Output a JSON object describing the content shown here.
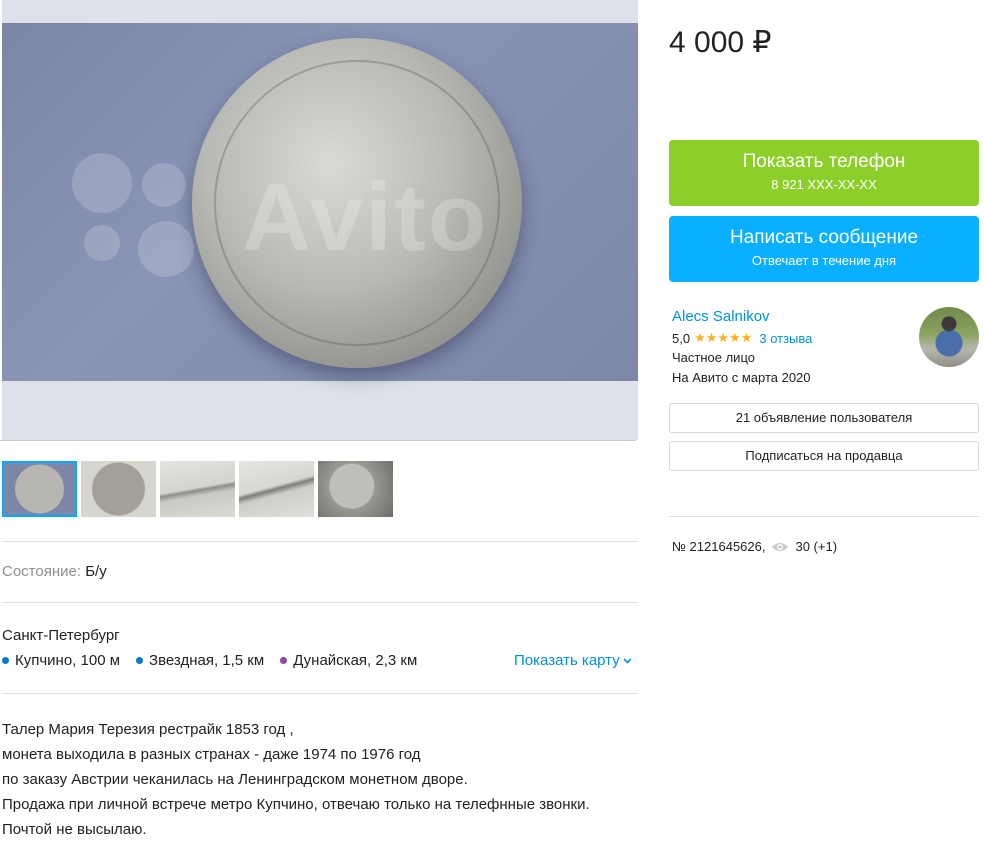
{
  "gallery": {
    "watermark": "Avito",
    "thumbnails": [
      "coin-obverse",
      "coin-reverse",
      "coin-edge-1",
      "coin-edge-2",
      "coin-in-holder"
    ]
  },
  "params": {
    "condition_label": "Состояние:",
    "condition_value": "Б/у"
  },
  "location": {
    "city": "Санкт-Петербург",
    "metro": [
      {
        "name": "Купчино, 100 м",
        "color": "#0078c9"
      },
      {
        "name": "Звездная, 1,5 км",
        "color": "#0078c9"
      },
      {
        "name": "Дунайская, 2,3 км",
        "color": "#8e479c"
      }
    ],
    "map_link": "Показать карту"
  },
  "description": [
    "Талер Мария Терезия рестрайк 1853 год ,",
    "монета выходила в разных странах - даже 1974 по 1976 год",
    "по заказу Австрии чеканилась на Ленинградском монетном дворе.",
    "Продажа при личной встрече метро Купчино, отвечаю только на телефнные звонки.",
    "Почтой не высылаю."
  ],
  "sidebar": {
    "price": "4 000 ₽",
    "show_phone": {
      "label": "Показать телефон",
      "sub": "8 921 XXX-XX-XX",
      "color": "#8ccf2a"
    },
    "write_message": {
      "label": "Написать сообщение",
      "sub": "Отвечает в течение дня",
      "color": "#0aafff"
    },
    "seller": {
      "name": "Alecs Salnikov",
      "rating": "5,0",
      "stars": "★★★★★",
      "reviews": "3 отзыва",
      "type": "Частное лицо",
      "since": "На Авито с марта 2020"
    },
    "user_ads_button": "21 объявление пользователя",
    "subscribe_button": "Подписаться на продавца",
    "ad_number": "№ 2121645626,",
    "views": "30 (+1)"
  }
}
